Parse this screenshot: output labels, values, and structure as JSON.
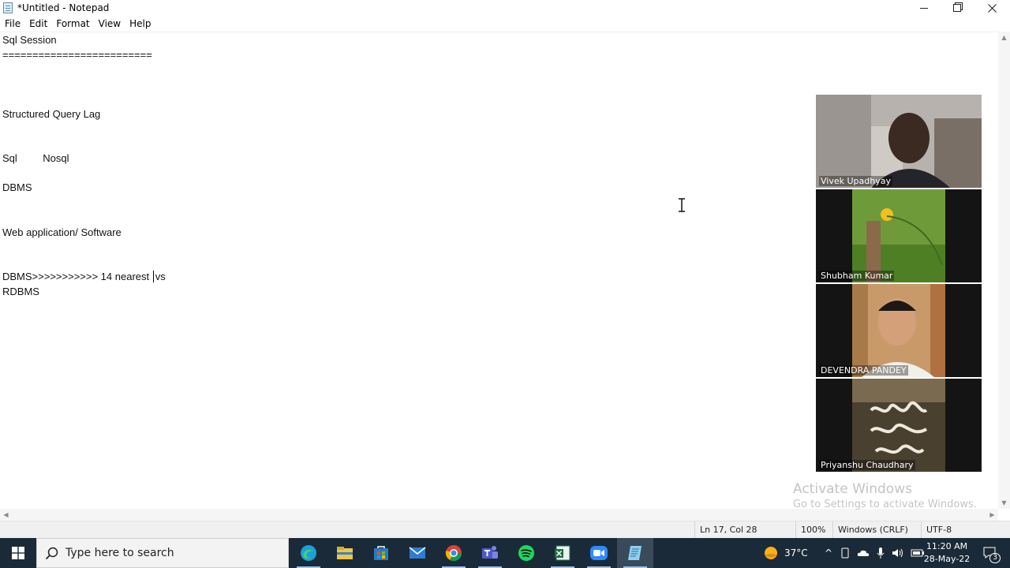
{
  "window": {
    "title": "*Untitled - Notepad"
  },
  "menu": [
    "File",
    "Edit",
    "Format",
    "View",
    "Help"
  ],
  "editor": {
    "lines": [
      "Sql Session",
      "=========================",
      "Structured Query Lag",
      "Sql         Nosql",
      "DBMS",
      "Web application/ Software",
      "DBMS>>>>>>>>>>> 14 nearest",
      "vs",
      "RDBMS"
    ]
  },
  "status": {
    "position": "Ln 17, Col 28",
    "zoom": "100%",
    "line_ending": "Windows (CRLF)",
    "encoding": "UTF-8"
  },
  "participants": [
    {
      "name": "Vivek Upadhyay"
    },
    {
      "name": "Shubham Kumar"
    },
    {
      "name": "DEVENDRA PANDEY"
    },
    {
      "name": "Priyanshu Chaudhary"
    }
  ],
  "watermark": {
    "heading": "Activate Windows",
    "subtext": "Go to Settings to activate Windows."
  },
  "taskbar": {
    "search_placeholder": "Type here to search",
    "apps": [
      "edge-icon",
      "file-explorer-icon",
      "store-icon",
      "mail-icon",
      "chrome-icon",
      "teams-icon",
      "spotify-icon",
      "excel-icon",
      "zoom-icon",
      "notepad-icon"
    ],
    "weather": "37°C",
    "time": "11:20 AM",
    "date": "28-May-22",
    "notification_count": "3"
  },
  "colors": {
    "taskbar_bg": "#1b2a38",
    "status_bar_bg": "#f0f0f0",
    "watermark_text": "#c4c4c4"
  }
}
